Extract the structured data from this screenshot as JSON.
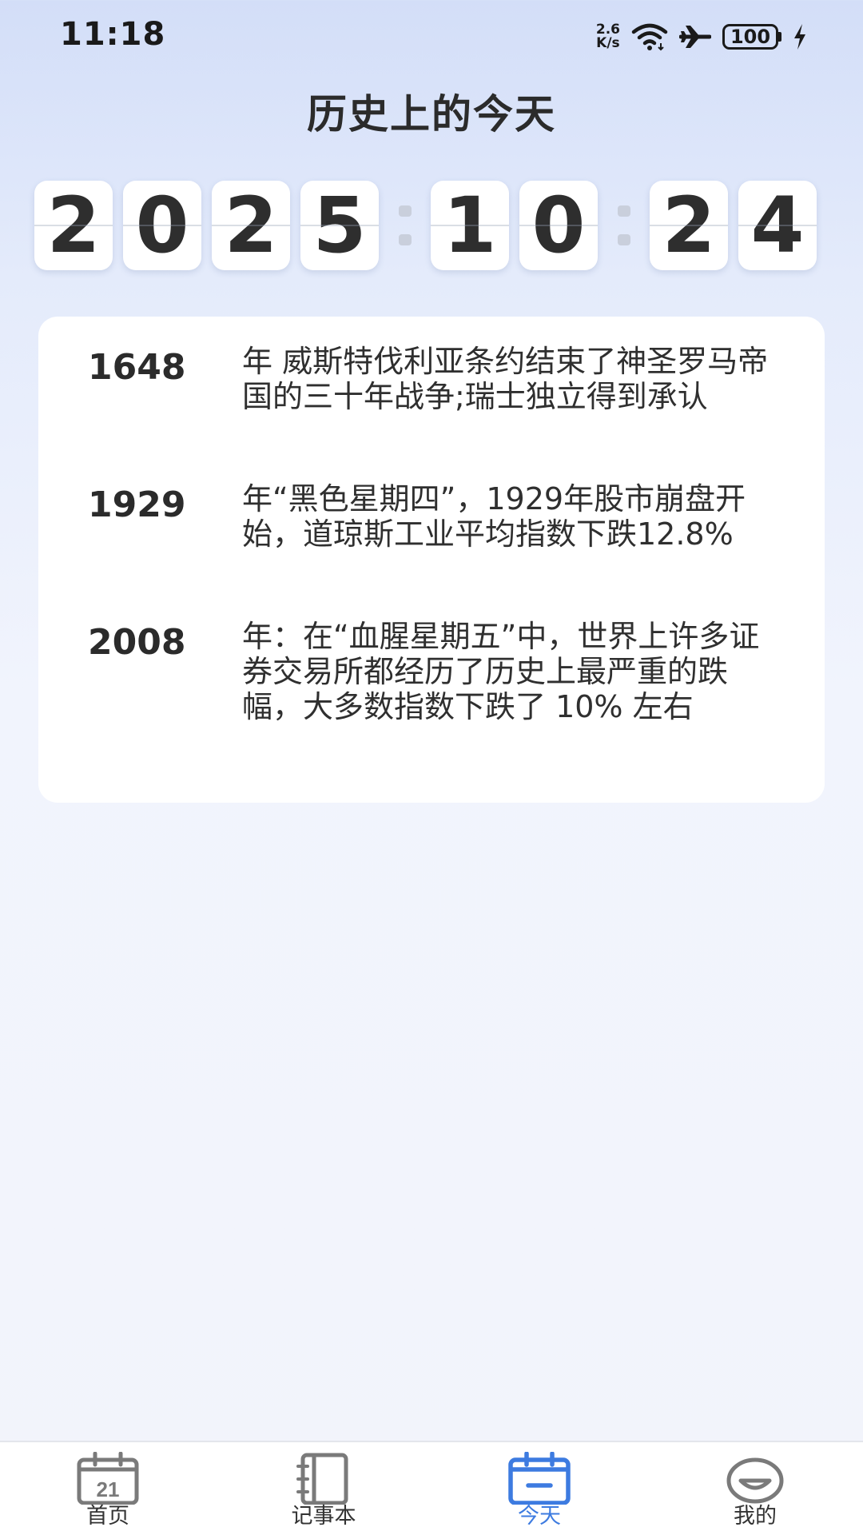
{
  "status_bar": {
    "time": "11:18",
    "net_speed_value": "2.6",
    "net_speed_unit": "K/s",
    "battery": "100",
    "icons": [
      "wifi-icon",
      "airplane-icon",
      "battery-icon",
      "charging-icon"
    ]
  },
  "header": {
    "title": "历史上的今天"
  },
  "date": {
    "year_digits": [
      "2",
      "0",
      "2",
      "5"
    ],
    "month_digits": [
      "1",
      "0"
    ],
    "day_digits": [
      "2",
      "4"
    ]
  },
  "events": [
    {
      "year": "1648",
      "text": "年 威斯特伐利亚条约结束了神圣罗马帝国的三十年战争;瑞士独立得到承认"
    },
    {
      "year": "1929",
      "text": "年“黑色星期四”，1929年股市崩盘开始，道琼斯工业平均指数下跌12.8%"
    },
    {
      "year": "2008",
      "text": " 年：在“血腥星期五”中，世界上许多证券交易所都经历了历史上最严重的跌幅，大多数指数下跌了 10% 左右"
    }
  ],
  "nav": {
    "items": [
      {
        "label": "首页",
        "icon": "calendar-21-icon",
        "active": false,
        "icon_number": "21"
      },
      {
        "label": "记事本",
        "icon": "notebook-icon",
        "active": false
      },
      {
        "label": "今天",
        "icon": "calendar-today-icon",
        "active": true
      },
      {
        "label": "我的",
        "icon": "profile-face-icon",
        "active": false
      }
    ],
    "colors": {
      "active": "#3d7be0",
      "inactive": "#7a7a7a"
    }
  }
}
